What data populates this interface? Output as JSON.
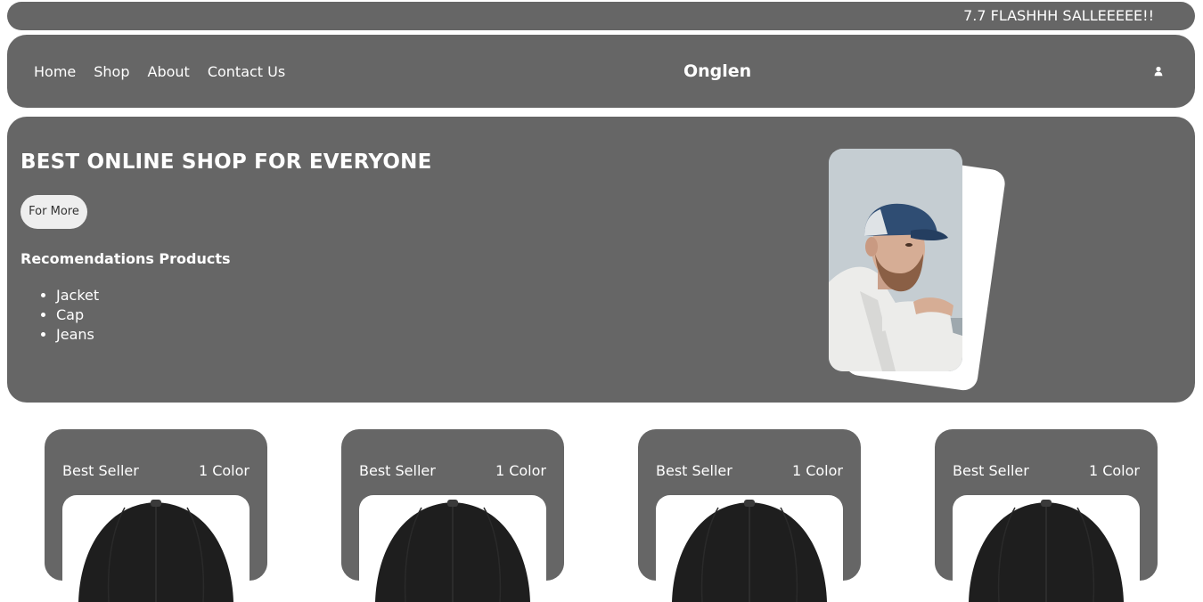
{
  "promo": {
    "text": "7.7 FLASHHH SALLEEEEE!!"
  },
  "nav": {
    "links": [
      "Home",
      "Shop",
      "About",
      "Contact Us"
    ],
    "brand": "Onglen",
    "user_icon": "user-icon"
  },
  "hero": {
    "title": "BEST ONLINE SHOP FOR EVERYONE",
    "button_label": "For More",
    "rec_title": "Recomendations Products",
    "rec_items": [
      "Jacket",
      "Cap",
      "Jeans"
    ],
    "image": "man-in-cap-photo"
  },
  "products": [
    {
      "badge": "Best Seller",
      "colors": "1 Color",
      "image": "black-cap"
    },
    {
      "badge": "Best Seller",
      "colors": "1 Color",
      "image": "black-cap"
    },
    {
      "badge": "Best Seller",
      "colors": "1 Color",
      "image": "black-cap"
    },
    {
      "badge": "Best Seller",
      "colors": "1 Color",
      "image": "black-cap"
    }
  ],
  "colors": {
    "panel": "#666666",
    "text": "#ffffff",
    "button_bg": "#eeeeee"
  }
}
